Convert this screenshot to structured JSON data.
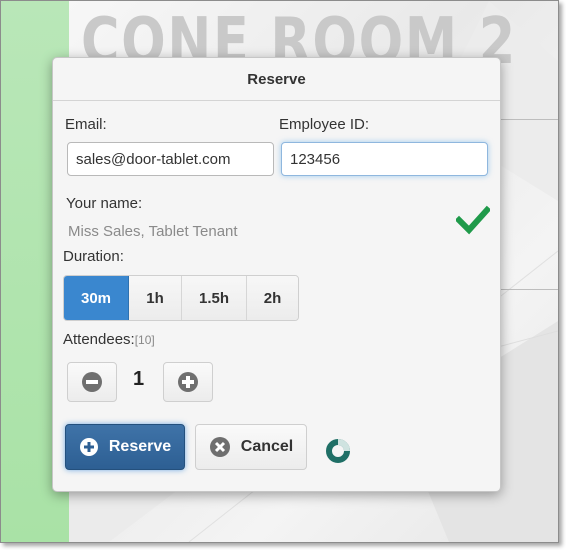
{
  "background": {
    "room_title": "CONE ROOM 2",
    "accent_green": "#a9e2a6"
  },
  "dialog": {
    "title": "Reserve",
    "email": {
      "label": "Email:",
      "value": "sales@door-tablet.com"
    },
    "employee_id": {
      "label": "Employee ID:",
      "value": "123456"
    },
    "your_name": {
      "label": "Your name:",
      "value": "Miss Sales, Tablet Tenant",
      "verified_icon": "check-icon"
    },
    "duration": {
      "label": "Duration:",
      "options": [
        "30m",
        "1h",
        "1.5h",
        "2h"
      ],
      "selected": "30m"
    },
    "attendees": {
      "label": "Attendees:",
      "max": "[10]",
      "count": "1"
    },
    "buttons": {
      "reserve": "Reserve",
      "cancel": "Cancel"
    },
    "colors": {
      "primary": "#3a87cf",
      "reserve_button": "#2d5f93",
      "success": "#1f9a4a",
      "spinner": "#1f6f66"
    }
  }
}
